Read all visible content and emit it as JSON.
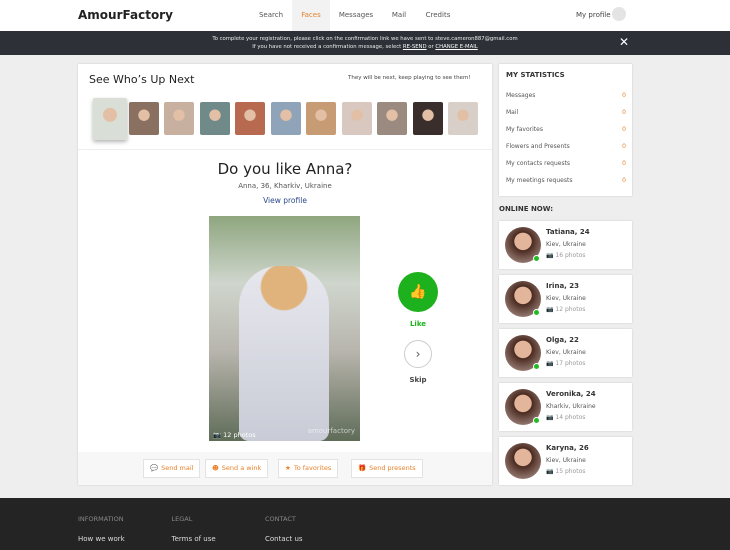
{
  "header": {
    "logo": "AmourFactory",
    "nav": [
      "Search",
      "Faces",
      "Messages",
      "Mail",
      "Credits"
    ],
    "active": "Faces",
    "my_profile": "My profile"
  },
  "banner": {
    "line1": "To complete your registration, please click on the confirmation link we have sent to steve.cameron887@gmail.com",
    "line2_pre": "If you have not received a confirmation message, select",
    "resend": "RE-SEND",
    "or": "or",
    "change": "CHANGE E-MAIL"
  },
  "upnext": {
    "title": "See Who’s Up Next",
    "note": "They will be next, keep playing to see them!"
  },
  "profile": {
    "question": "Do you like Anna?",
    "subtitle": "Anna, 36, Kharkiv, Ukraine",
    "view": "View profile",
    "photos": "12 photos",
    "watermark": "amourfactory",
    "like": "Like",
    "skip": "Skip"
  },
  "actions": [
    "Send mail",
    "Send a wink",
    "To favorites",
    "Send presents"
  ],
  "stats": {
    "title": "MY STATISTICS",
    "rows": [
      {
        "label": "Messages",
        "value": "0"
      },
      {
        "label": "Mail",
        "value": "0"
      },
      {
        "label": "My favorites",
        "value": "0"
      },
      {
        "label": "Flowers and Presents",
        "value": "0"
      },
      {
        "label": "My contacts requests",
        "value": "0"
      },
      {
        "label": "My meetings requests",
        "value": "0"
      }
    ]
  },
  "online": {
    "title": "ONLINE NOW:",
    "people": [
      {
        "name": "Tatiana, 24",
        "city": "Kiev, Ukraine",
        "photos": "16 photos",
        "online": true
      },
      {
        "name": "Irina, 23",
        "city": "Kiev, Ukraine",
        "photos": "12 photos",
        "online": true
      },
      {
        "name": "Olga, 22",
        "city": "Kiev, Ukraine",
        "photos": "17 photos",
        "online": true
      },
      {
        "name": "Veronika, 24",
        "city": "Kharkiv, Ukraine",
        "photos": "14 photos",
        "online": true
      },
      {
        "name": "Karyna, 26",
        "city": "Kiev, Ukraine",
        "photos": "15 photos",
        "online": false
      }
    ]
  },
  "footer": {
    "cols": [
      {
        "head": "INFORMATION",
        "link": "How we work"
      },
      {
        "head": "LEGAL",
        "link": "Terms of use"
      },
      {
        "head": "CONTACT",
        "link": "Contact us"
      }
    ]
  },
  "colors": {
    "accent": "#e8822b",
    "like": "#1db11d",
    "banner": "#2d3037",
    "footer": "#242424"
  }
}
